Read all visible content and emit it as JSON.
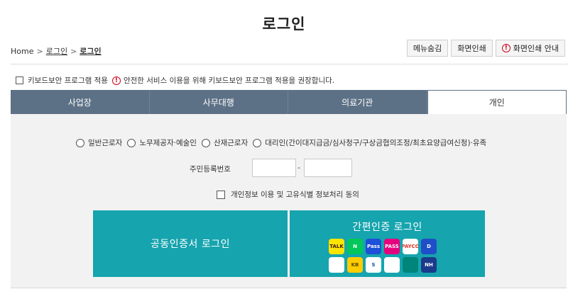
{
  "page": {
    "title": "로그인"
  },
  "breadcrumb": {
    "home": "Home",
    "sep": ">",
    "level1": "로그인",
    "current": "로그인"
  },
  "top_buttons": {
    "menu_hide": "메뉴숨김",
    "print": "화면인쇄",
    "print_guide": "화면인쇄 안내"
  },
  "keyboard_security": {
    "label": "키보드보안 프로그램 적용",
    "warn_glyph": "!",
    "notice": "안전한 서비스 이용을 위해 키보드보안 프로그램 적용을 권장합니다."
  },
  "tabs": [
    {
      "label": "사업장"
    },
    {
      "label": "사무대행"
    },
    {
      "label": "의료기관"
    },
    {
      "label": "개인"
    }
  ],
  "radios": [
    {
      "label": "일반근로자"
    },
    {
      "label": "노무제공자·예술인"
    },
    {
      "label": "산재근로자"
    },
    {
      "label": "대리인(간이대지급금/심사청구/구상금협의조정/최초요양급여신청)·유족"
    }
  ],
  "rrn": {
    "label": "주민등록번호",
    "dash": "-"
  },
  "consent": {
    "label": "개인정보 이용 및 고유식별 정보처리 동의"
  },
  "login": {
    "cert_label": "공동인증서 로그인",
    "simple_label": "간편인증 로그인"
  },
  "simple_apps": [
    {
      "icon": "kakao-icon",
      "text": "TALK",
      "bg": "#fee500",
      "fg": "#3c1e1e"
    },
    {
      "icon": "naver-icon",
      "text": "N",
      "bg": "#03c75a",
      "fg": "#ffffff"
    },
    {
      "icon": "samsung-pass-icon",
      "text": "Pass",
      "bg": "#1d4fd8",
      "fg": "#ffffff"
    },
    {
      "icon": "pass-icon",
      "text": "PASS",
      "bg": "#e6007e",
      "fg": "#ffffff"
    },
    {
      "icon": "payco-icon",
      "text": "PAYCO",
      "bg": "#ffffff",
      "fg": "#e03127"
    },
    {
      "icon": "shield-auth-icon",
      "text": "D",
      "bg": "#1f4fc8",
      "fg": "#ffffff"
    },
    {
      "icon": "toss-icon",
      "text": "",
      "bg": "#ffffff",
      "fg": "#1a73e8"
    },
    {
      "icon": "kb-icon",
      "text": "KB",
      "bg": "#ffcc00",
      "fg": "#5c4a00"
    },
    {
      "icon": "shinhan-icon",
      "text": "S",
      "bg": "#ffffff",
      "fg": "#1b4fa0"
    },
    {
      "icon": "banksalad-icon",
      "text": "",
      "bg": "#ffffff",
      "fg": "#19b36b"
    },
    {
      "icon": "hana-icon",
      "text": "",
      "bg": "#00857a",
      "fg": "#ffffff"
    },
    {
      "icon": "nh-icon",
      "text": "NH",
      "bg": "#1a3a8c",
      "fg": "#ffffff"
    }
  ]
}
